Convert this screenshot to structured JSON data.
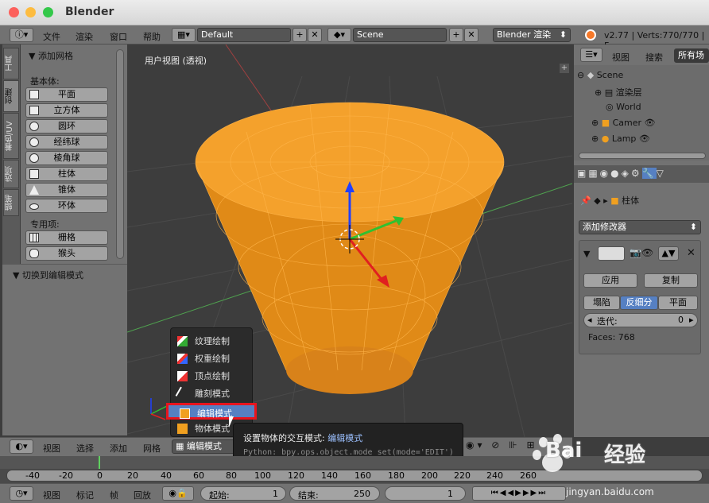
{
  "window": {
    "title": "Blender"
  },
  "menubar": {
    "items": [
      "文件",
      "渲染",
      "窗口",
      "帮助"
    ],
    "layout": "Default",
    "scene": "Scene",
    "engine": "Blender 渲染",
    "stats": "v2.77 | Verts:770/770 | F"
  },
  "lefttabs": [
    "工具",
    "创建",
    "关系",
    "着色/UV",
    "选项",
    "蜡笔"
  ],
  "tools": {
    "section_title": "添加网格",
    "basic_label": "基本体:",
    "basic": [
      "平面",
      "立方体",
      "圆环",
      "经纬球",
      "棱角球",
      "柱体",
      "锥体",
      "环体"
    ],
    "special_label": "专用项:",
    "special": [
      "栅格",
      "猴头"
    ],
    "toggle_section": "切换到编辑模式"
  },
  "viewport": {
    "label": "用户视图 (透视)"
  },
  "outliner": {
    "menus": [
      "视图",
      "搜索",
      "所有场"
    ],
    "tree": [
      "Scene",
      "渲染层",
      "World",
      "Camer",
      "Lamp"
    ]
  },
  "props": {
    "object_name": "柱体",
    "add_modifier": "添加修改器",
    "apply": "应用",
    "copy": "复制",
    "tabs": [
      "塌陷",
      "反细分",
      "平面"
    ],
    "iterations_label": "迭代:",
    "iterations_value": "0",
    "faces": "Faces: 768"
  },
  "vpheader": {
    "items": [
      "视图",
      "选择",
      "添加",
      "网格"
    ],
    "mode": "编辑模式"
  },
  "modemenu": {
    "items": [
      "纹理绘制",
      "权重绘制",
      "顶点绘制",
      "雕刻模式",
      "编辑模式",
      "物体模式"
    ],
    "selected": "编辑模式"
  },
  "tooltip": {
    "title": "设置物体的交互模式:",
    "title_value": "编辑模式",
    "python": "Python: bpy.ops.object.mode_set(mode='EDIT')"
  },
  "timeline": {
    "ticks": [
      "-40",
      "-20",
      "0",
      "20",
      "40",
      "60",
      "80",
      "100",
      "120",
      "140",
      "160",
      "180",
      "200",
      "220",
      "240",
      "260"
    ],
    "current_frame": 0
  },
  "timeheader": {
    "items": [
      "视图",
      "标记",
      "帧",
      "回放"
    ],
    "start_label": "起始:",
    "start_value": "1",
    "end_label": "结束:",
    "end_value": "250",
    "current": "1"
  },
  "watermark": {
    "brand": "Bai",
    "brand2": "经验",
    "url": "jingyan.baidu.com"
  },
  "colors": {
    "mesh": "#ff9a1a",
    "highlight": "#5680c2",
    "red_box": "#e8141e"
  }
}
